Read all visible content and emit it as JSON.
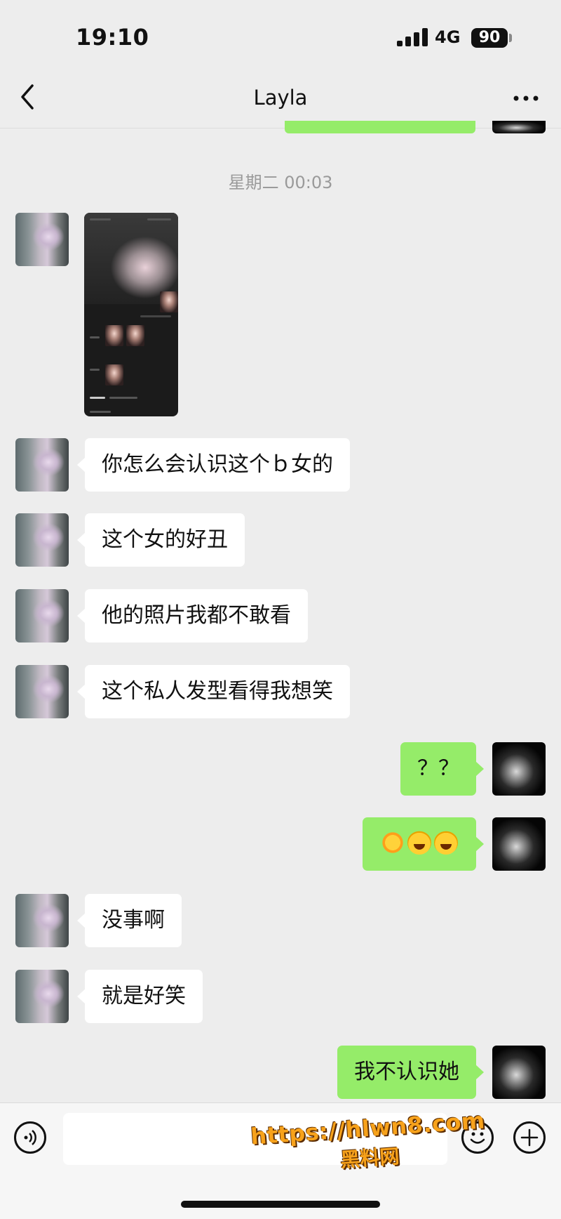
{
  "status_bar": {
    "time": "19:10",
    "network": "4G",
    "battery": "90"
  },
  "header": {
    "title": "Layla"
  },
  "timestamp": "星期二 00:03",
  "messages": [
    {
      "text": "你怎么会认识这个ｂ女的"
    },
    {
      "text": "这个女的好丑"
    },
    {
      "text": "他的照片我都不敢看"
    },
    {
      "text": "这个私人发型看得我想笑"
    },
    {
      "text": "？？"
    },
    {
      "text": ""
    },
    {
      "text": "没事啊"
    },
    {
      "text": "就是好笑"
    },
    {
      "text": "我不认识她"
    }
  ],
  "input": {
    "placeholder": ""
  },
  "watermark": {
    "url": "https://hlwn8.com",
    "name": "黑料网"
  },
  "colors": {
    "outgoing_bubble": "#95ec69",
    "incoming_bubble": "#ffffff",
    "background": "#ededed"
  }
}
